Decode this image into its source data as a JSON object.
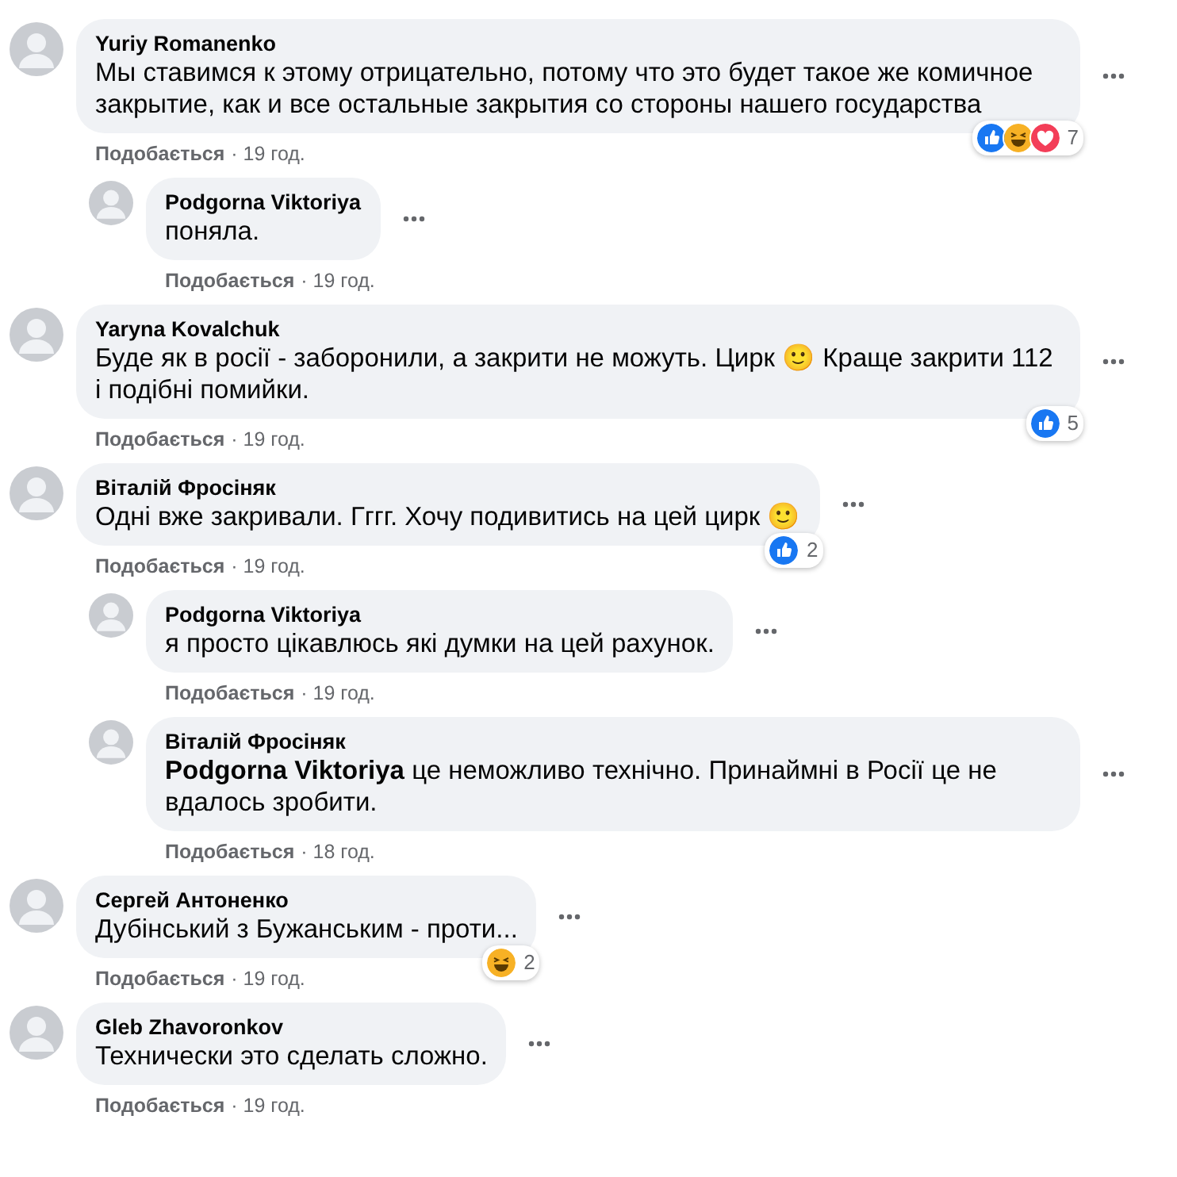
{
  "comments": [
    {
      "author": "Yuriy Romanenko",
      "text": "Мы ставимся к этому отрицательно, потому что это будет такое же комичное закрытие, как и все остальные закрытия со стороны нашего государства",
      "reactions": {
        "like": true,
        "haha": true,
        "love": true,
        "count": "7"
      },
      "like_label": "Подобається",
      "time": "· 19 год.",
      "children": [
        {
          "author": "Podgorna Viktoriya",
          "text": "поняла.",
          "like_label": "Подобається",
          "time": "· 19 год."
        }
      ]
    },
    {
      "author": "Yaryna Kovalchuk",
      "text": "Буде як в росії - заборонили, а закрити не можуть. Цирк 🙂 Краще закрити 112 і подібні помийки.",
      "reactions": {
        "like": true,
        "haha": false,
        "love": false,
        "count": "5"
      },
      "like_label": "Подобається",
      "time": "· 19 год."
    },
    {
      "author": "Віталій Фросіняк",
      "text": "Одні вже закривали. Гггг. Хочу подивитись на цей цирк 🙂",
      "reactions": {
        "like": true,
        "haha": false,
        "love": false,
        "count": "2"
      },
      "like_label": "Подобається",
      "time": "· 19 год.",
      "children": [
        {
          "author": "Podgorna Viktoriya",
          "text": "я просто цікавлюсь які думки на цей рахунок.",
          "like_label": "Подобається",
          "time": "· 19 год."
        },
        {
          "author": "Віталій Фросіняк",
          "text": "**Podgorna Viktoriya** це неможливо технічно. Принаймні в Росії це не вдалось зробити.",
          "like_label": "Подобається",
          "time": "· 18 год."
        }
      ]
    },
    {
      "author": "Сергей Антоненко",
      "text": "Дубінський з Бужанським - проти...",
      "reactions": {
        "like": false,
        "haha": true,
        "love": false,
        "count": "2"
      },
      "like_label": "Подобається",
      "time": "· 19 год."
    },
    {
      "author": "Gleb Zhavoronkov",
      "text": "Технически это сделать сложно.",
      "like_label": "Подобається",
      "time": "· 19 год."
    }
  ]
}
